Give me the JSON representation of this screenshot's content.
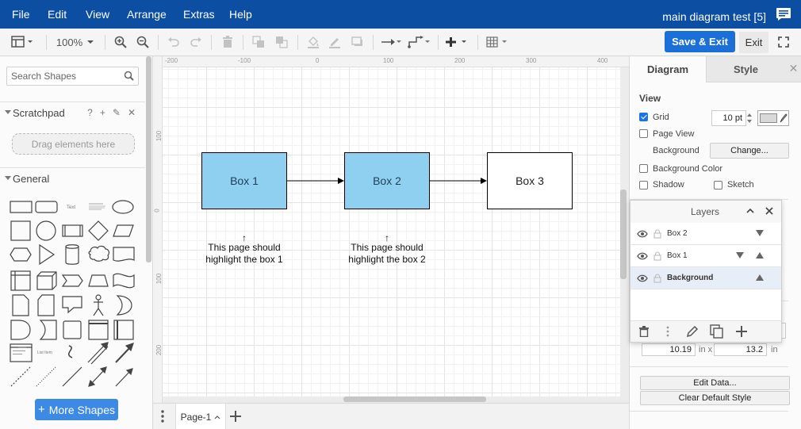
{
  "menubar": {
    "items": [
      "File",
      "Edit",
      "View",
      "Arrange",
      "Extras",
      "Help"
    ],
    "title": "main diagram test [5]",
    "color": "#0b4ea2"
  },
  "toolbar": {
    "zoom": "100%",
    "save_exit": "Save & Exit",
    "exit": "Exit"
  },
  "left": {
    "search_placeholder": "Search Shapes",
    "scratchpad": "Scratchpad",
    "scratchpad_icons": [
      "?",
      "+",
      "✎",
      "✕"
    ],
    "drag_here": "Drag elements here",
    "general": "General",
    "text_shape": "Text",
    "list_shape": "List Item",
    "more_shapes": "More Shapes"
  },
  "ruler": {
    "top": [
      "-200",
      "-100",
      "0",
      "100",
      "200",
      "300",
      "400"
    ],
    "left": [
      "100",
      "0",
      "100",
      "200"
    ]
  },
  "diagram": {
    "boxes": [
      {
        "label": "Box 1",
        "fill": "#8fd0f0"
      },
      {
        "label": "Box 2",
        "fill": "#8fd0f0"
      },
      {
        "label": "Box 3",
        "fill": "#ffffff"
      }
    ],
    "notes": [
      {
        "arrow": "↑",
        "line1": "This page should",
        "line2": "highlight the box 1"
      },
      {
        "arrow": "↑",
        "line1": "This page should",
        "line2": "highlight the box 2"
      }
    ]
  },
  "pages": {
    "current": "Page-1"
  },
  "right": {
    "tabs": [
      "Diagram",
      "Style"
    ],
    "view_title": "View",
    "grid_label": "Grid",
    "grid_size": "10 pt",
    "page_view": "Page View",
    "background": "Background",
    "change": "Change...",
    "background_color": "Background Color",
    "shadow": "Shadow",
    "sketch": "Sketch",
    "width_value": "10.19",
    "height_value": "13.2",
    "unit_in": "in",
    "unit_x": "in x",
    "edit_data": "Edit Data...",
    "clear_default": "Clear Default Style"
  },
  "layers": {
    "title": "Layers",
    "rows": [
      {
        "name": "Box 2"
      },
      {
        "name": "Box 1"
      },
      {
        "name": "Background"
      }
    ]
  }
}
